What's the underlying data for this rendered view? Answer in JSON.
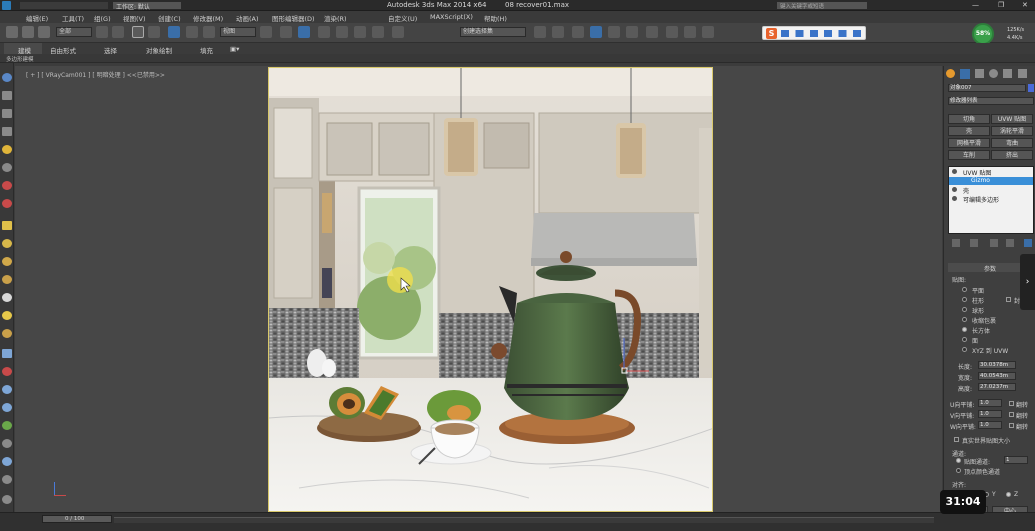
{
  "window": {
    "title": "Autodesk 3ds Max  2014 x64",
    "file": "08 recover01.max",
    "workspace": "工作区: 默认",
    "search_placeholder": "键入关键字或短语"
  },
  "menu": [
    "编辑(E)",
    "工具(T)",
    "组(G)",
    "视图(V)",
    "创建(C)",
    "修改器(M)",
    "动画(A)",
    "图形编辑器(D)",
    "渲染(R)",
    "自定义(U)",
    "MAXScript(X)",
    "帮助(H)"
  ],
  "toolbar": {
    "selection_filter": "全部",
    "view_dropdown": "视图",
    "named_selection": "创建选择集"
  },
  "ribbon": {
    "tabs": [
      "建模",
      "自由形式",
      "选择",
      "对象绘制",
      "填充"
    ],
    "subtitle": "多边形建模"
  },
  "viewport": {
    "label": "[ + ] [ VRayCam001 ] [ 明暗处理 ]  <<已禁用>>"
  },
  "status_widget": {
    "percent": "58%",
    "up": "125K/s",
    "down": "4.4K/s"
  },
  "ime_bar": "S",
  "command_panel": {
    "object_name": "对象007",
    "modifier_list": "修改器列表",
    "buttons": [
      [
        "切角",
        "UVW 贴图"
      ],
      [
        "壳",
        "涡轮平滑"
      ],
      [
        "网格平滑",
        "弯曲"
      ],
      [
        "车削",
        "挤出"
      ]
    ],
    "stack": [
      {
        "label": "UVW 贴图",
        "selected": false
      },
      {
        "label": "Gizmo",
        "selected": true
      },
      {
        "label": "壳",
        "selected": false
      },
      {
        "label": "可编辑多边形",
        "selected": false
      }
    ],
    "rollout_title": "参数",
    "mapping_title": "贴图:",
    "mapping_options": [
      "平面",
      "柱形",
      "球形",
      "收缩包裹",
      "长方体",
      "面",
      "XYZ 到 UVW"
    ],
    "mapping_selected": 4,
    "cap_label": "封口",
    "length_label": "长度:",
    "length_value": "30.0378m",
    "width_label": "宽度:",
    "width_value": "40.0543m",
    "height_label": "高度:",
    "height_value": "27.0237m",
    "u_tile_label": "U向平铺:",
    "u_tile_value": "1.0",
    "v_tile_label": "V向平铺:",
    "v_tile_value": "1.0",
    "w_tile_label": "W向平铺:",
    "w_tile_value": "1.0",
    "flip_label": "翻转",
    "realworld_label": "真实世界贴图大小",
    "channel_title": "通道:",
    "map_channel_label": "贴图通道:",
    "map_channel_value": "1",
    "vertex_color_label": "顶点颜色通道",
    "align_title": "对齐:",
    "axis_labels": [
      "X",
      "Y",
      "Z"
    ],
    "operate_buttons": [
      "操纵",
      "中心"
    ]
  },
  "timeline": {
    "frame": "0 / 100"
  },
  "video_overlay": {
    "time": "31:04"
  }
}
